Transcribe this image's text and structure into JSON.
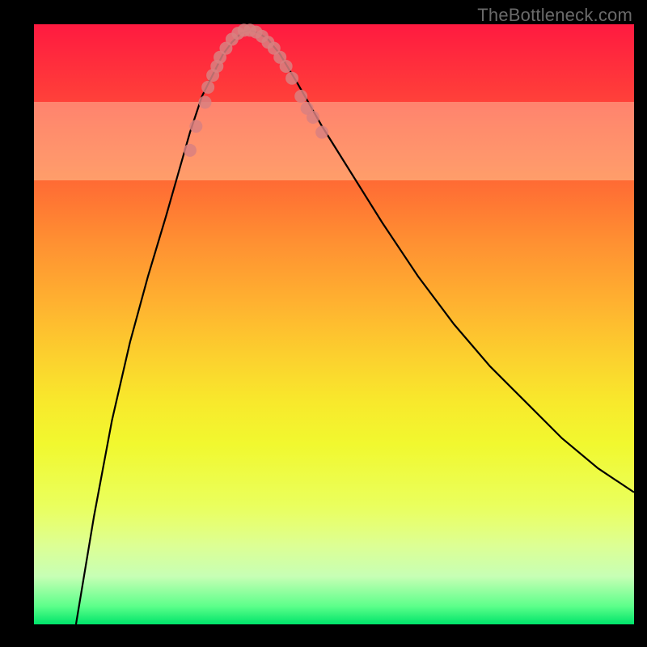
{
  "watermark": "TheBottleneck.com",
  "colors": {
    "background": "#000000",
    "gradient_top": "#ff1a40",
    "gradient_bottom": "#00e46a",
    "curve": "#000000",
    "markers": "#d98080",
    "glow": "#ffffd2"
  },
  "chart_data": {
    "type": "line",
    "title": "",
    "xlabel": "",
    "ylabel": "",
    "xlim": [
      0,
      100
    ],
    "ylim": [
      0,
      100
    ],
    "glow_band_y": [
      74,
      87
    ],
    "series": [
      {
        "name": "bottleneck-curve",
        "x": [
          7,
          10,
          13,
          16,
          19,
          22,
          24,
          26,
          28,
          30,
          31.5,
          33,
          34.5,
          36,
          37.5,
          39,
          41,
          44,
          48,
          53,
          58,
          64,
          70,
          76,
          82,
          88,
          94,
          100
        ],
        "y": [
          0,
          18,
          34,
          47,
          58,
          68,
          75,
          82,
          88,
          92,
          95,
          97,
          98.5,
          99,
          98.5,
          97.5,
          95,
          90,
          83,
          75,
          67,
          58,
          50,
          43,
          37,
          31,
          26,
          22
        ]
      }
    ],
    "markers": {
      "name": "highlighted-points",
      "x": [
        26.0,
        27.0,
        28.5,
        29.0,
        29.8,
        30.5,
        31.0,
        32.0,
        33.0,
        34.0,
        35.0,
        36.0,
        37.0,
        38.0,
        39.0,
        40.0,
        41.0,
        42.0,
        43.0,
        44.5,
        45.5,
        46.5,
        48.0
      ],
      "y": [
        79.0,
        83.0,
        87.0,
        89.5,
        91.5,
        93.0,
        94.5,
        96.0,
        97.5,
        98.5,
        99.0,
        99.0,
        98.7,
        98.0,
        97.0,
        96.0,
        94.5,
        93.0,
        91.0,
        88.0,
        86.0,
        84.5,
        82.0
      ]
    }
  }
}
